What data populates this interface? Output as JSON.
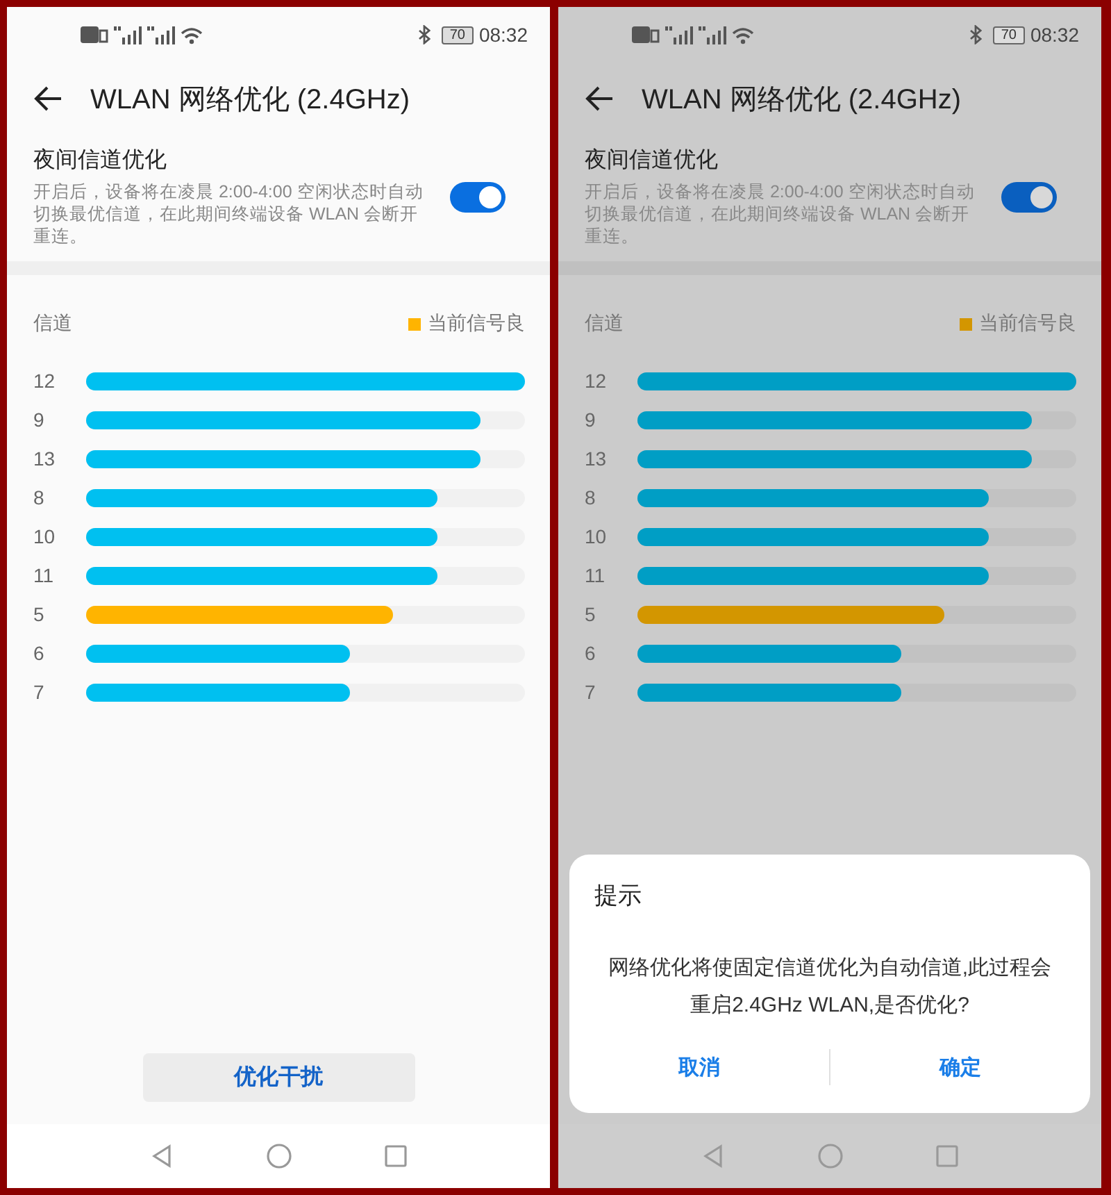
{
  "screens": [
    {
      "dimmed": false,
      "status_bar": {
        "battery": "70",
        "time": "08:32"
      },
      "title": "WLAN 网络优化 (2.4GHz)",
      "night_optimization": {
        "label": "夜间信道优化",
        "description": "开启后，设备将在凌晨 2:00-4:00 空闲状态时自动切换最优信道，在此期间终端设备 WLAN 会断开重连。",
        "on": true
      },
      "chart_header": {
        "label": "信道",
        "legend": {
          "label": "当前信号良",
          "color": "#ffb400"
        }
      },
      "channels": [
        {
          "name": "12",
          "level": 1.0,
          "color": "#00c0f0"
        },
        {
          "name": "9",
          "level": 0.9,
          "color": "#00c0f0"
        },
        {
          "name": "13",
          "level": 0.9,
          "color": "#00c0f0"
        },
        {
          "name": "8",
          "level": 0.8,
          "color": "#00c0f0"
        },
        {
          "name": "10",
          "level": 0.8,
          "color": "#00c0f0"
        },
        {
          "name": "11",
          "level": 0.8,
          "color": "#00c0f0"
        },
        {
          "name": "5",
          "level": 0.7,
          "color": "#ffb400"
        },
        {
          "name": "6",
          "level": 0.6,
          "color": "#00c0f0"
        },
        {
          "name": "7",
          "level": 0.6,
          "color": "#00c0f0"
        }
      ],
      "button": "优化干扰"
    },
    {
      "dimmed": true,
      "status_bar": {
        "battery": "70",
        "time": "08:32"
      },
      "title": "WLAN 网络优化 (2.4GHz)",
      "night_optimization": {
        "label": "夜间信道优化",
        "description": "开启后，设备将在凌晨 2:00-4:00 空闲状态时自动切换最优信道，在此期间终端设备 WLAN 会断开重连。",
        "on": true
      },
      "chart_header": {
        "label": "信道",
        "legend": {
          "label": "当前信号良",
          "color": "#d39600"
        }
      },
      "channels": [
        {
          "name": "12",
          "level": 1.0,
          "color": "#009ec5"
        },
        {
          "name": "9",
          "level": 0.9,
          "color": "#009ec5"
        },
        {
          "name": "13",
          "level": 0.9,
          "color": "#009ec5"
        },
        {
          "name": "8",
          "level": 0.8,
          "color": "#009ec5"
        },
        {
          "name": "10",
          "level": 0.8,
          "color": "#009ec5"
        },
        {
          "name": "11",
          "level": 0.8,
          "color": "#009ec5"
        },
        {
          "name": "5",
          "level": 0.7,
          "color": "#d39600"
        },
        {
          "name": "6",
          "level": 0.6,
          "color": "#009ec5"
        },
        {
          "name": "7",
          "level": 0.6,
          "color": "#009ec5"
        }
      ],
      "dialog": {
        "title": "提示",
        "message": "网络优化将使固定信道优化为自动信道,此过程会重启2.4GHz WLAN,是否优化?",
        "buttons": [
          "取消",
          "确定"
        ]
      }
    }
  ]
}
